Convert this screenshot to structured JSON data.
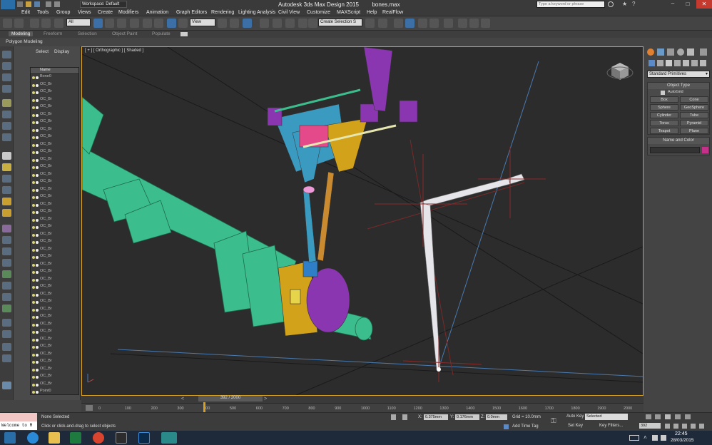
{
  "titlebar": {
    "workspace_label": "Workspace: Default",
    "app_title": "Autodesk 3ds Max Design 2015",
    "file_name": "bones.max",
    "search_placeholder": "Type a keyword or phrase"
  },
  "menubar": {
    "items": [
      "Edit",
      "Tools",
      "Group",
      "Views",
      "Create",
      "Modifiers",
      "Animation",
      "Graph Editors",
      "Rendering",
      "Lighting Analysis",
      "Civil View",
      "Customize",
      "MAXScript",
      "Help",
      "RealFlow"
    ]
  },
  "toolbar": {
    "filter_value": "All",
    "refcoord_value": "View",
    "selection_set_value": "Create Selection S"
  },
  "ribbon": {
    "tabs": [
      "Modeling",
      "Freeform",
      "Selection",
      "Object Paint",
      "Populate"
    ],
    "sub_label": "Polygon Modeling"
  },
  "scene_explorer": {
    "tabs": [
      "Select",
      "Display"
    ],
    "column_header": "Name",
    "rows": [
      "Bone0",
      "OC_Br",
      "OC_Br",
      "OC_Br",
      "OC_Br",
      "OC_Br",
      "OC_Br",
      "OC_Br",
      "OC_Br",
      "OC_Br",
      "OC_Br",
      "OC_Br",
      "OC_Br",
      "OC_Br",
      "OC_Br",
      "OC_Br",
      "OC_Br",
      "OC_Br",
      "OC_Br",
      "OC_Br",
      "OC_Br",
      "OC_Br",
      "OC_Br",
      "OC_Br",
      "OC_Br",
      "OC_Br",
      "OC_Br",
      "OC_Br",
      "OC_Br",
      "OC_Br",
      "OC_Br",
      "OC_Br",
      "OC_Br",
      "OC_Br",
      "OC_Br",
      "OC_Br",
      "OC_Br",
      "OC_Br",
      "OC_Br",
      "OC_Br",
      "OC_Br",
      "OC_Br",
      "Point0"
    ]
  },
  "viewport": {
    "label": "[ + ] [ Orthographic ] [ Shaded ]"
  },
  "command_panel": {
    "dropdown_value": "Standard Primitives",
    "object_type_header": "Object Type",
    "autogrid_label": "AutoGrid",
    "buttons": [
      "Box",
      "Cone",
      "Sphere",
      "GeoSphere",
      "Cylinder",
      "Tube",
      "Torus",
      "Pyramid",
      "Teapot",
      "Plane"
    ],
    "name_color_header": "Name and Color",
    "swatch_color": "#c4308a"
  },
  "timeline": {
    "frame_label": "392 / 2000",
    "ticks": [
      "0",
      "100",
      "200",
      "300",
      "400",
      "500",
      "600",
      "700",
      "800",
      "900",
      "1000",
      "1100",
      "1200",
      "1300",
      "1400",
      "1500",
      "1600",
      "1700",
      "1800",
      "1900",
      "2000"
    ]
  },
  "statusbar": {
    "maxscript_text": "Welcome to M",
    "selection_status": "None Selected",
    "prompt": "Click or click-and-drag to select objects",
    "x_label": "X:",
    "x_value": "0.375mm",
    "y_label": "Y:",
    "y_value": "0.176mm",
    "z_label": "Z:",
    "z_value": "0.0mm",
    "grid": "Grid = 10.0mm",
    "add_time_tag": "Add Time Tag",
    "auto_key": "Auto Key",
    "key_mode_value": "Selected",
    "set_key": "Set Key",
    "key_filters": "Key Filters...",
    "current_frame": "392"
  },
  "taskbar": {
    "time": "22:45",
    "date": "28/03/2015"
  },
  "colors": {
    "viewport_border": "#d8a020",
    "axle_green": "#3cbd8d",
    "accent_blue": "#3b6fa6"
  }
}
